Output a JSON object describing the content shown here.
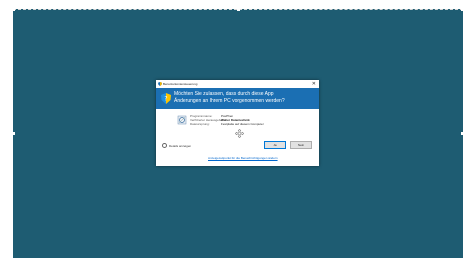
{
  "dialog": {
    "title": "Benutzerkontensteuerung",
    "question_line1": "Möchten Sie zulassen, dass durch diese App",
    "question_line2": "Änderungen an Ihrem PC vorgenommen werden?",
    "details": [
      {
        "label": "Programmname:",
        "value": "PcePhen"
      },
      {
        "label": "Verifizierter Herausgeber:",
        "value": "Walter Datentechnik"
      },
      {
        "label": "Dateiursprung:",
        "value": "Festplatte auf diesem Computer"
      }
    ],
    "show_details_label": "Details anzeigen",
    "yes_label": "Ja",
    "no_label": "Nein",
    "settings_link": "Anzeigezeitpunkt für die Benachrichtigungen ändern"
  },
  "colors": {
    "desktop": "#1e5c72",
    "header": "#1b6fb3",
    "link": "#0066cc"
  }
}
